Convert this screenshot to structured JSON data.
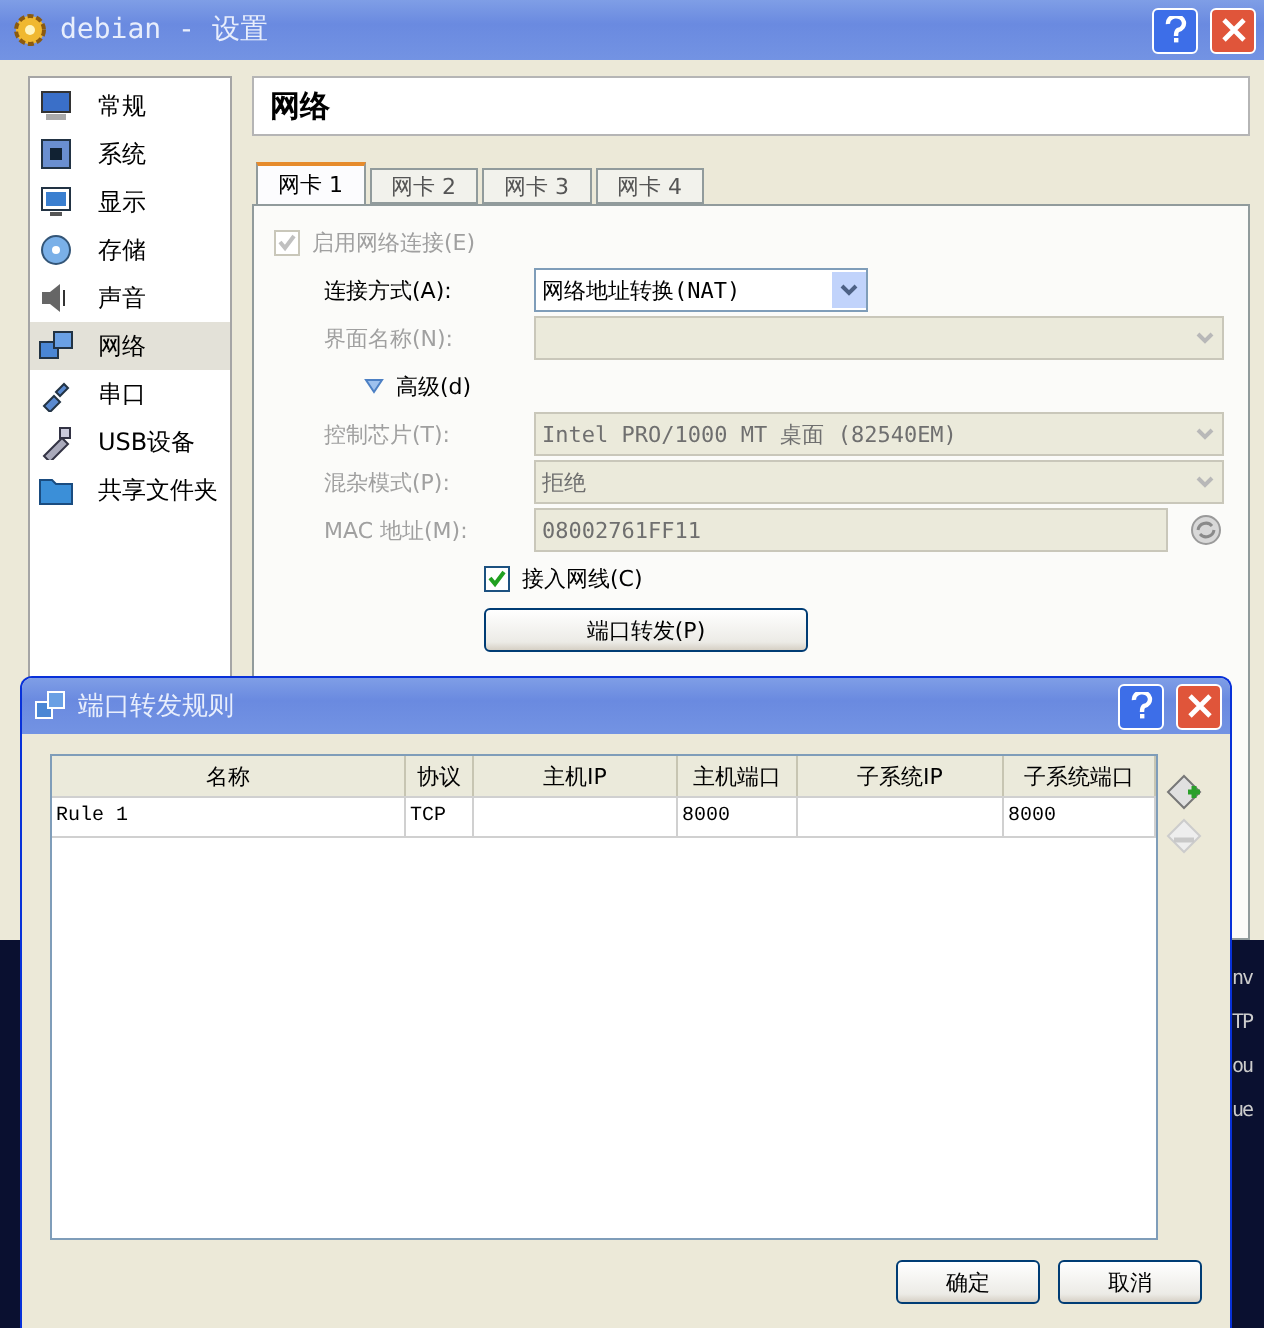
{
  "window": {
    "title": "debian - 设置"
  },
  "sidebar": {
    "items": [
      {
        "label": "常规",
        "kind": "monitor",
        "selected": false
      },
      {
        "label": "系统",
        "kind": "chip",
        "selected": false
      },
      {
        "label": "显示",
        "kind": "display",
        "selected": false
      },
      {
        "label": "存储",
        "kind": "disc",
        "selected": false
      },
      {
        "label": "声音",
        "kind": "speaker",
        "selected": false
      },
      {
        "label": "网络",
        "kind": "network",
        "selected": true
      },
      {
        "label": "串口",
        "kind": "plug",
        "selected": false
      },
      {
        "label": "USB设备",
        "kind": "usb",
        "selected": false
      },
      {
        "label": "共享文件夹",
        "kind": "folder",
        "selected": false
      }
    ]
  },
  "page_title": "网络",
  "tabs": [
    {
      "label": "网卡 1",
      "selected": true
    },
    {
      "label": "网卡 2",
      "selected": false
    },
    {
      "label": "网卡 3",
      "selected": false
    },
    {
      "label": "网卡 4",
      "selected": false
    }
  ],
  "enable_adapter": {
    "label": "启用网络连接(E)",
    "checked": true,
    "disabled": true
  },
  "fields": [
    {
      "kind": "select",
      "label": "连接方式(A):",
      "value": "网络地址转换(NAT)",
      "disabled": false
    },
    {
      "kind": "select",
      "label": "界面名称(N):",
      "disabled": true
    },
    {
      "kind": "expander",
      "label": "高级(d)",
      "expanded": true
    },
    {
      "kind": "select",
      "label": "控制芯片(T):",
      "value": "Intel PRO/1000 MT 桌面 (82540EM)",
      "disabled": true
    },
    {
      "kind": "select",
      "label": "混杂模式(P):",
      "value": "拒绝",
      "disabled": true
    },
    {
      "kind": "text",
      "label": "MAC 地址(M):",
      "value": "08002761FF11",
      "disabled": true
    },
    {
      "kind": "checkbox",
      "label": "接入网线(C)",
      "checked": true
    },
    {
      "kind": "button",
      "label": "端口转发(P)"
    }
  ],
  "terminal_lines": [
    "nv",
    "TP",
    "ou",
    "ue"
  ],
  "dialog": {
    "title": "端口转发规则",
    "columns": [
      "名称",
      "协议",
      "主机IP",
      "主机端口",
      "子系统IP",
      "子系统端口"
    ],
    "rows": [
      {
        "name": "Rule 1",
        "protocol": "TCP",
        "host_port": "8000",
        "guest_port": "8000"
      }
    ],
    "tools": [
      {
        "kind": "add",
        "disabled": false
      },
      {
        "kind": "remove",
        "disabled": true
      }
    ],
    "buttons": [
      "确定",
      "取消"
    ]
  }
}
